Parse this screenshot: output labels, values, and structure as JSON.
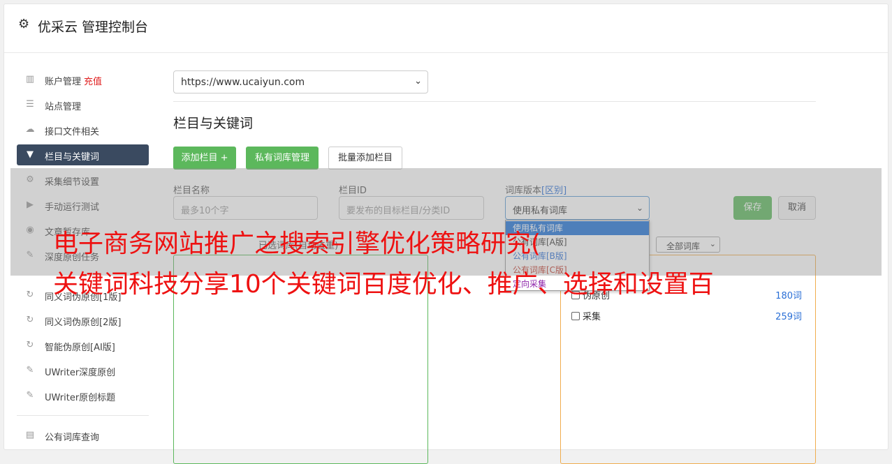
{
  "app": {
    "title": "优采云 管理控制台",
    "icon": "gear-icon"
  },
  "sidebar": {
    "items": [
      {
        "label": "账户管理",
        "extra": "充值",
        "icon": "bar-chart-icon"
      },
      {
        "label": "站点管理",
        "icon": "server-icon"
      },
      {
        "label": "接口文件相关",
        "icon": "cloud-upload-icon"
      },
      {
        "label": "栏目与关键词",
        "icon": "filter-icon",
        "active": true
      },
      {
        "label": "采集细节设置",
        "icon": "cogs-icon"
      },
      {
        "label": "手动运行测试",
        "icon": "play-circle-icon"
      },
      {
        "label": "文章暂存库",
        "icon": "database-icon"
      },
      {
        "label": "深度原创任务",
        "icon": "edit-icon"
      },
      {
        "label": "同义词伪原创[1版]",
        "icon": "refresh-icon"
      },
      {
        "label": "同义词伪原创[2版]",
        "icon": "refresh-icon"
      },
      {
        "label": "智能伪原创[AI版]",
        "icon": "refresh-icon"
      },
      {
        "label": "UWriter深度原创",
        "icon": "edit-icon"
      },
      {
        "label": "UWriter原创标题",
        "icon": "edit-icon"
      },
      {
        "label": "公有词库查询",
        "icon": "book-icon"
      }
    ]
  },
  "site_select": {
    "value": "https://www.ucaiyun.com"
  },
  "section": {
    "title": "栏目与关键词"
  },
  "actions": {
    "add_column": "添加栏目 +",
    "private_lib": "私有词库管理",
    "batch_add": "批量添加栏目"
  },
  "form": {
    "name_label": "栏目名称",
    "name_placeholder": "最多10个字",
    "id_label": "栏目ID",
    "id_placeholder": "要发布的目标栏目/分类ID",
    "version_label": "词库版本",
    "version_hint": "[区别]",
    "version_value": "使用私有词库",
    "version_options": [
      "使用私有词库",
      "公有词库[A版]",
      "公有词库[B版]",
      "公有词库[C版]",
      "定向采集"
    ],
    "save": "保存",
    "cancel": "取消"
  },
  "selected_lib_label": "已选词库(自动去重)",
  "lib_filter": {
    "value": "全部词库"
  },
  "libraries": [
    {
      "name": "伪原创",
      "count": "180词"
    },
    {
      "name": "采集",
      "count": "259词"
    }
  ],
  "watermark": {
    "line1": "电子商务网站推广之搜索引擎优化策略研究(",
    "line2": "关键词科技分享10个关键词百度优化、推广、选择和设置百"
  }
}
